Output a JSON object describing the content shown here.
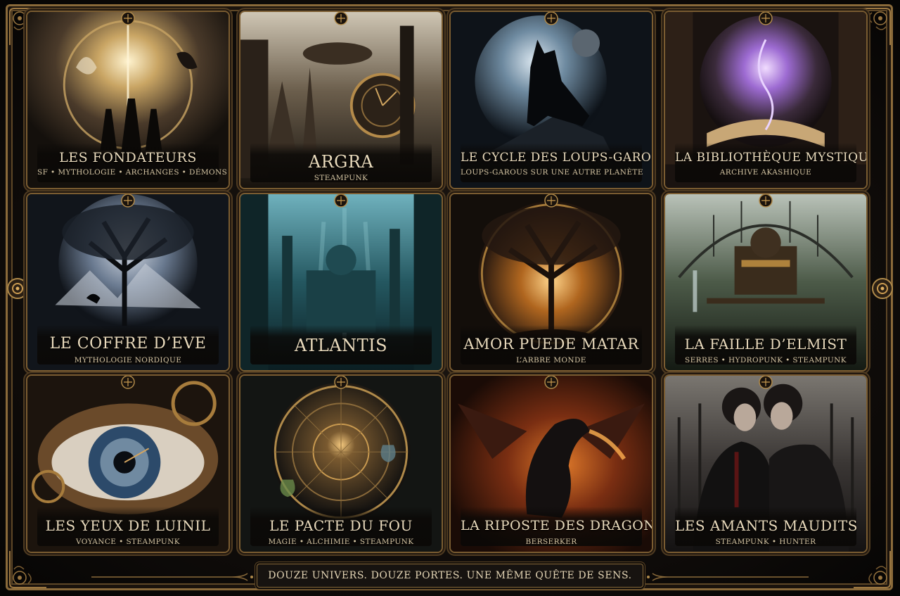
{
  "colors": {
    "gold": "#b08a4a",
    "gold_dark": "#5e4727",
    "text": "#eadbbd",
    "background": "#0e0b09"
  },
  "cards": [
    {
      "title": "LES FONDATEURS",
      "subtitle": "SF • MYTHOLOGIE • ARCHANGES • DÉMONS",
      "theme": "sky-light"
    },
    {
      "title": "ARGRA",
      "subtitle": "STEAMPUNK",
      "theme": "steampunk-city"
    },
    {
      "title": "LE CYCLE DES LOUPS-GAROUS",
      "subtitle": "LOUPS-GAROUS SUR UNE AUTRE PLANÈTE",
      "theme": "wolf-moon"
    },
    {
      "title": "LA BIBLIOTHÈQUE MYSTIQUE",
      "subtitle": "ARCHIVE AKASHIQUE",
      "theme": "mystic-book"
    },
    {
      "title": "LE COFFRE D’EVE",
      "subtitle": "MYTHOLOGIE NORDIQUE",
      "theme": "norse-tree"
    },
    {
      "title": "ATLANTIS",
      "subtitle": "",
      "theme": "underwater-city"
    },
    {
      "title": "AMOR PUEDE MATAR",
      "subtitle": "L’ARBRE MONDE",
      "theme": "golden-tree"
    },
    {
      "title": "LA FAILLE D’ELMIST",
      "subtitle": "SERRES • HYDROPUNK • STEAMPUNK",
      "theme": "greenhouse"
    },
    {
      "title": "LES YEUX DE LUINIL",
      "subtitle": "VOYANCE • STEAMPUNK",
      "theme": "clockwork-eye"
    },
    {
      "title": "LE PACTE DU FOU",
      "subtitle": "MAGIE • ALCHIMIE • STEAMPUNK",
      "theme": "alchemy-circle"
    },
    {
      "title": "LA RIPOSTE DES DRAGONS",
      "subtitle": "BERSERKER",
      "theme": "fire-dragon"
    },
    {
      "title": "LES AMANTS MAUDITS",
      "subtitle": "STEAMPUNK • HUNTER",
      "theme": "two-lovers"
    }
  ],
  "tagline": "DOUZE UNIVERS. DOUZE PORTES. UNE MÊME QUÊTE DE SENS."
}
